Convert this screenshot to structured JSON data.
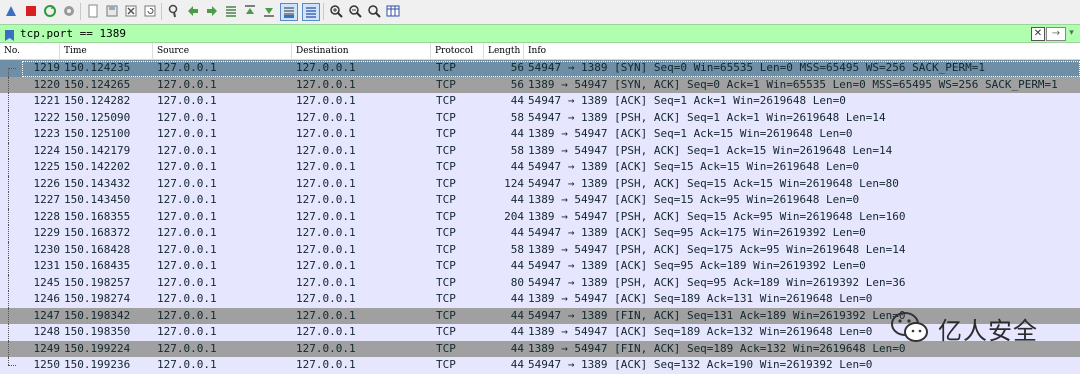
{
  "toolbar": {
    "buttons": [
      {
        "name": "shark-fin-icon"
      },
      {
        "name": "stop-icon"
      },
      {
        "name": "restart-icon"
      },
      {
        "name": "options-icon"
      },
      {
        "name": "open-file-icon"
      },
      {
        "name": "save-file-icon"
      },
      {
        "name": "close-file-icon"
      },
      {
        "name": "reload-icon"
      },
      {
        "name": "find-packet-icon"
      },
      {
        "name": "back-icon"
      },
      {
        "name": "forward-icon"
      },
      {
        "name": "goto-packet-icon"
      },
      {
        "name": "go-first-icon"
      },
      {
        "name": "go-last-icon"
      },
      {
        "name": "autoscroll-icon"
      },
      {
        "name": "colorize-icon"
      },
      {
        "name": "zoom-in-icon"
      },
      {
        "name": "zoom-out-icon"
      },
      {
        "name": "normal-size-icon"
      },
      {
        "name": "resize-columns-icon"
      }
    ]
  },
  "filter": {
    "value": "tcp.port == 1389",
    "clear_label": "✕",
    "apply_label": "→",
    "dropdown_label": "▾",
    "background": "#afffaf"
  },
  "columns": {
    "no": "No.",
    "time": "Time",
    "source": "Source",
    "destination": "Destination",
    "protocol": "Protocol",
    "length": "Length",
    "info": "Info"
  },
  "rows": [
    {
      "no": "1219",
      "time": "150.124235",
      "src": "127.0.0.1",
      "dst": "127.0.0.1",
      "proto": "TCP",
      "len": "56",
      "info": "54947 → 1389 [SYN] Seq=0 Win=65535 Len=0 MSS=65495 WS=256 SACK_PERM=1",
      "bg": "#6f8fa7",
      "fg": "#12272e"
    },
    {
      "no": "1220",
      "time": "150.124265",
      "src": "127.0.0.1",
      "dst": "127.0.0.1",
      "proto": "TCP",
      "len": "56",
      "info": "1389 → 54947 [SYN, ACK] Seq=0 Ack=1 Win=65535 Len=0 MSS=65495 WS=256 SACK_PERM=1",
      "bg": "#a0a0a0",
      "fg": "#12272e"
    },
    {
      "no": "1221",
      "time": "150.124282",
      "src": "127.0.0.1",
      "dst": "127.0.0.1",
      "proto": "TCP",
      "len": "44",
      "info": "54947 → 1389 [ACK] Seq=1 Ack=1 Win=2619648 Len=0",
      "bg": "#e7e6ff",
      "fg": "#12272e"
    },
    {
      "no": "1222",
      "time": "150.125090",
      "src": "127.0.0.1",
      "dst": "127.0.0.1",
      "proto": "TCP",
      "len": "58",
      "info": "54947 → 1389 [PSH, ACK] Seq=1 Ack=1 Win=2619648 Len=14",
      "bg": "#e7e6ff",
      "fg": "#12272e"
    },
    {
      "no": "1223",
      "time": "150.125100",
      "src": "127.0.0.1",
      "dst": "127.0.0.1",
      "proto": "TCP",
      "len": "44",
      "info": "1389 → 54947 [ACK] Seq=1 Ack=15 Win=2619648 Len=0",
      "bg": "#e7e6ff",
      "fg": "#12272e"
    },
    {
      "no": "1224",
      "time": "150.142179",
      "src": "127.0.0.1",
      "dst": "127.0.0.1",
      "proto": "TCP",
      "len": "58",
      "info": "1389 → 54947 [PSH, ACK] Seq=1 Ack=15 Win=2619648 Len=14",
      "bg": "#e7e6ff",
      "fg": "#12272e"
    },
    {
      "no": "1225",
      "time": "150.142202",
      "src": "127.0.0.1",
      "dst": "127.0.0.1",
      "proto": "TCP",
      "len": "44",
      "info": "54947 → 1389 [ACK] Seq=15 Ack=15 Win=2619648 Len=0",
      "bg": "#e7e6ff",
      "fg": "#12272e"
    },
    {
      "no": "1226",
      "time": "150.143432",
      "src": "127.0.0.1",
      "dst": "127.0.0.1",
      "proto": "TCP",
      "len": "124",
      "info": "54947 → 1389 [PSH, ACK] Seq=15 Ack=15 Win=2619648 Len=80",
      "bg": "#e7e6ff",
      "fg": "#12272e"
    },
    {
      "no": "1227",
      "time": "150.143450",
      "src": "127.0.0.1",
      "dst": "127.0.0.1",
      "proto": "TCP",
      "len": "44",
      "info": "1389 → 54947 [ACK] Seq=15 Ack=95 Win=2619648 Len=0",
      "bg": "#e7e6ff",
      "fg": "#12272e"
    },
    {
      "no": "1228",
      "time": "150.168355",
      "src": "127.0.0.1",
      "dst": "127.0.0.1",
      "proto": "TCP",
      "len": "204",
      "info": "1389 → 54947 [PSH, ACK] Seq=15 Ack=95 Win=2619648 Len=160",
      "bg": "#e7e6ff",
      "fg": "#12272e"
    },
    {
      "no": "1229",
      "time": "150.168372",
      "src": "127.0.0.1",
      "dst": "127.0.0.1",
      "proto": "TCP",
      "len": "44",
      "info": "54947 → 1389 [ACK] Seq=95 Ack=175 Win=2619392 Len=0",
      "bg": "#e7e6ff",
      "fg": "#12272e"
    },
    {
      "no": "1230",
      "time": "150.168428",
      "src": "127.0.0.1",
      "dst": "127.0.0.1",
      "proto": "TCP",
      "len": "58",
      "info": "1389 → 54947 [PSH, ACK] Seq=175 Ack=95 Win=2619648 Len=14",
      "bg": "#e7e6ff",
      "fg": "#12272e"
    },
    {
      "no": "1231",
      "time": "150.168435",
      "src": "127.0.0.1",
      "dst": "127.0.0.1",
      "proto": "TCP",
      "len": "44",
      "info": "54947 → 1389 [ACK] Seq=95 Ack=189 Win=2619392 Len=0",
      "bg": "#e7e6ff",
      "fg": "#12272e"
    },
    {
      "no": "1245",
      "time": "150.198257",
      "src": "127.0.0.1",
      "dst": "127.0.0.1",
      "proto": "TCP",
      "len": "80",
      "info": "54947 → 1389 [PSH, ACK] Seq=95 Ack=189 Win=2619392 Len=36",
      "bg": "#e7e6ff",
      "fg": "#12272e"
    },
    {
      "no": "1246",
      "time": "150.198274",
      "src": "127.0.0.1",
      "dst": "127.0.0.1",
      "proto": "TCP",
      "len": "44",
      "info": "1389 → 54947 [ACK] Seq=189 Ack=131 Win=2619648 Len=0",
      "bg": "#e7e6ff",
      "fg": "#12272e"
    },
    {
      "no": "1247",
      "time": "150.198342",
      "src": "127.0.0.1",
      "dst": "127.0.0.1",
      "proto": "TCP",
      "len": "44",
      "info": "54947 → 1389 [FIN, ACK] Seq=131 Ack=189 Win=2619392 Len=0",
      "bg": "#a0a0a0",
      "fg": "#12272e"
    },
    {
      "no": "1248",
      "time": "150.198350",
      "src": "127.0.0.1",
      "dst": "127.0.0.1",
      "proto": "TCP",
      "len": "44",
      "info": "1389 → 54947 [ACK] Seq=189 Ack=132 Win=2619648 Len=0",
      "bg": "#e7e6ff",
      "fg": "#12272e"
    },
    {
      "no": "1249",
      "time": "150.199224",
      "src": "127.0.0.1",
      "dst": "127.0.0.1",
      "proto": "TCP",
      "len": "44",
      "info": "1389 → 54947 [FIN, ACK] Seq=189 Ack=132 Win=2619648 Len=0",
      "bg": "#a0a0a0",
      "fg": "#12272e"
    },
    {
      "no": "1250",
      "time": "150.199236",
      "src": "127.0.0.1",
      "dst": "127.0.0.1",
      "proto": "TCP",
      "len": "44",
      "info": "54947 → 1389 [ACK] Seq=132 Ack=190 Win=2619392 Len=0",
      "bg": "#e7e6ff",
      "fg": "#12272e"
    }
  ],
  "selected_row": "1219",
  "watermark": {
    "text": "亿人安全",
    "icon": "wechat-icon"
  }
}
